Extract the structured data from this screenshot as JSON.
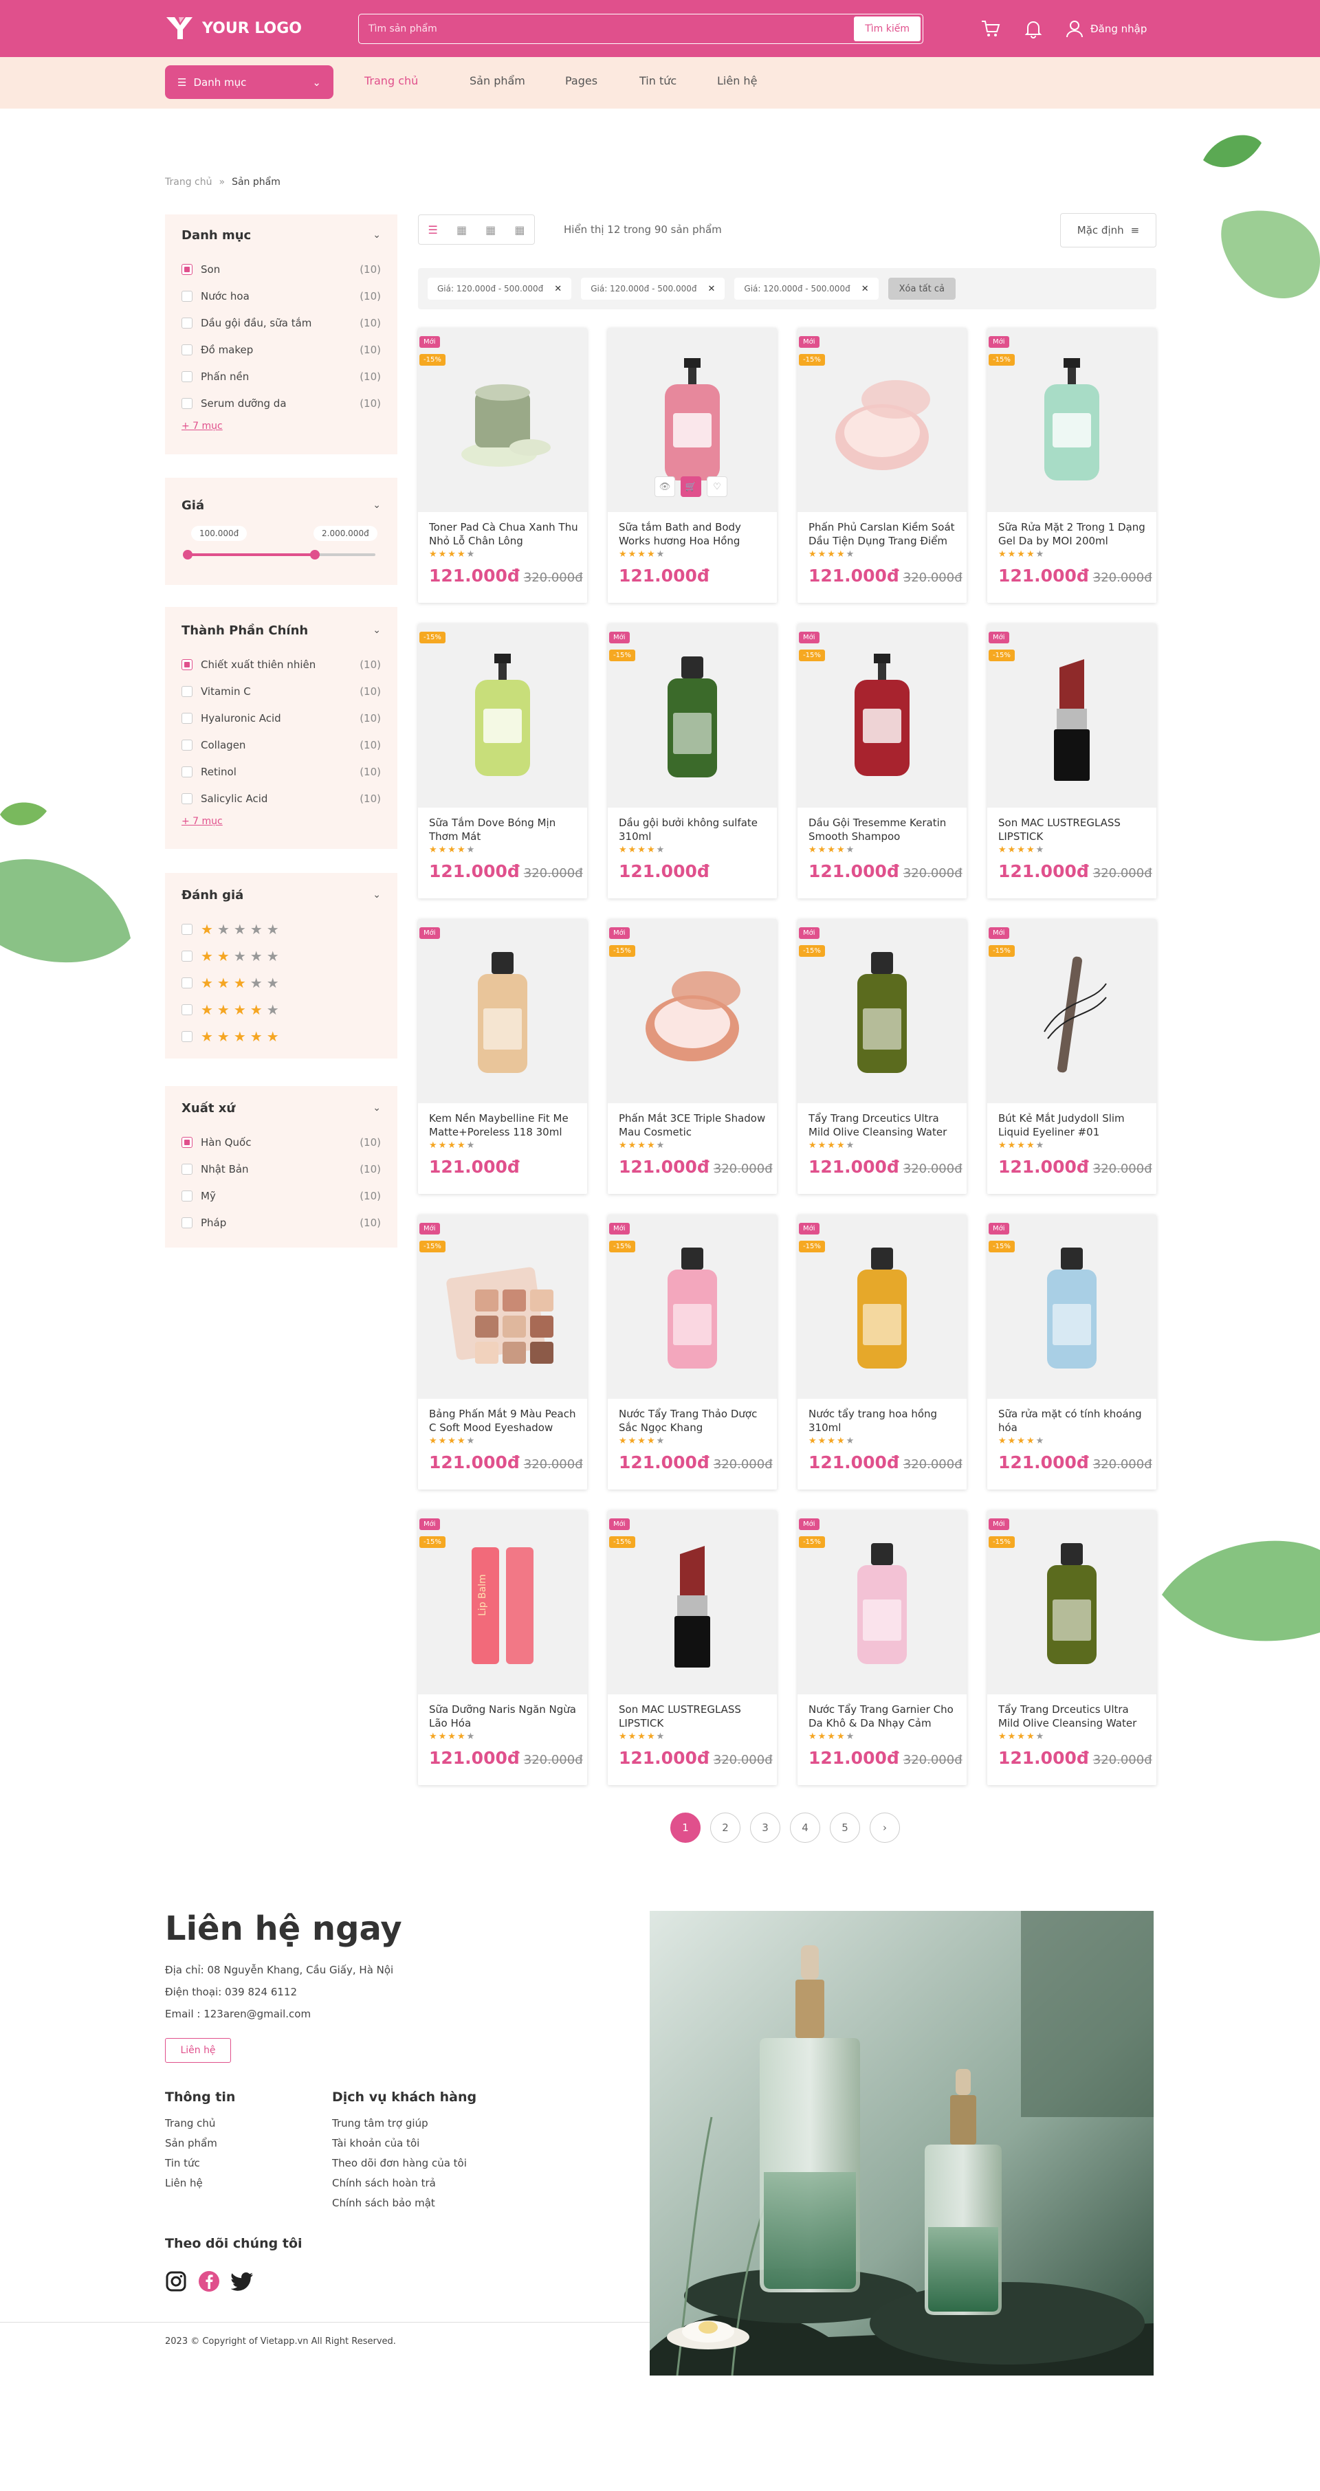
{
  "header": {
    "logo_text": "YOUR LOGO",
    "search_placeholder": "Tìm sản phẩm",
    "search_button": "Tìm kiếm",
    "login_label": "Đăng nhập"
  },
  "nav": {
    "category_button": "Danh mục",
    "links": [
      "Trang chủ",
      "Sản phẩm",
      "Pages",
      "Tin tức",
      "Liên hệ"
    ]
  },
  "breadcrumb": {
    "home": "Trang chủ",
    "current": "Sản phẩm"
  },
  "filters": {
    "category": {
      "title": "Danh mục",
      "options": [
        {
          "label": "Son",
          "count": "(10)",
          "checked": true
        },
        {
          "label": "Nước hoa",
          "count": "(10)",
          "checked": false
        },
        {
          "label": "Dầu gội đầu, sữa tắm",
          "count": "(10)",
          "checked": false
        },
        {
          "label": "Đồ makep",
          "count": "(10)",
          "checked": false
        },
        {
          "label": "Phấn nền",
          "count": "(10)",
          "checked": false
        },
        {
          "label": "Serum dưỡng da",
          "count": "(10)",
          "checked": false
        }
      ],
      "more": "+ 7 mục"
    },
    "price": {
      "title": "Giá",
      "min": "100.000đ",
      "max": "2.000.000đ",
      "range_fraction": [
        0.0,
        0.68
      ]
    },
    "ingredient": {
      "title": "Thành Phần Chính",
      "options": [
        {
          "label": "Chiết xuất thiên nhiên",
          "count": "(10)",
          "checked": true
        },
        {
          "label": "Vitamin C",
          "count": "(10)",
          "checked": false
        },
        {
          "label": "Hyaluronic Acid",
          "count": "(10)",
          "checked": false
        },
        {
          "label": "Collagen",
          "count": "(10)",
          "checked": false
        },
        {
          "label": "Retinol",
          "count": "(10)",
          "checked": false
        },
        {
          "label": "Salicylic Acid",
          "count": "(10)",
          "checked": false
        }
      ],
      "more": "+ 7 mục"
    },
    "rating": {
      "title": "Đánh giá",
      "options": [
        1,
        2,
        3,
        4,
        5
      ]
    },
    "origin": {
      "title": "Xuất xứ",
      "options": [
        {
          "label": "Hàn Quốc",
          "count": "(10)",
          "checked": true
        },
        {
          "label": "Nhật Bản",
          "count": "(10)",
          "checked": false
        },
        {
          "label": "Mỹ",
          "count": "(10)",
          "checked": false
        },
        {
          "label": "Pháp",
          "count": "(10)",
          "checked": false
        }
      ]
    }
  },
  "toolbar": {
    "showing": "Hiển thị 12 trong 90 sản phẩm",
    "sort": "Mặc định",
    "chips": [
      "Giá: 120.000đ - 500.000đ",
      "Giá: 120.000đ - 500.000đ",
      "Giá: 120.000đ - 500.000đ"
    ],
    "clear_all": "Xóa tất cả"
  },
  "products": [
    {
      "name": "Toner Pad Cà Chua Xanh Thu Nhỏ Lỗ Chân Lông",
      "price": "121.000đ",
      "old": "320.000đ",
      "new": "Mới",
      "off": "-15%",
      "stars": 4,
      "kind": "jar",
      "color": "#9aa988"
    },
    {
      "name": "Sữa tắm Bath and Body Works hương Hoa Hồng",
      "price": "121.000đ",
      "old": "",
      "new": "",
      "off": "",
      "stars": 4,
      "kind": "pump",
      "color": "#e7889c",
      "hover": true
    },
    {
      "name": "Phấn Phủ Carslan Kiềm Soát Dầu Tiện Dụng Trang Điểm",
      "price": "121.000đ",
      "old": "320.000đ",
      "new": "Mới",
      "off": "-15%",
      "stars": 4,
      "kind": "compact",
      "color": "#f2c9c6"
    },
    {
      "name": "Sữa Rửa Mặt 2 Trong 1 Dạng Gel Da by MOI 200ml",
      "price": "121.000đ",
      "old": "320.000đ",
      "new": "Mới",
      "off": "-15%",
      "stars": 4,
      "kind": "pump",
      "color": "#a8dcc6"
    },
    {
      "name": "Sữa Tắm Dove Bóng Mịn Thơm Mát",
      "price": "121.000đ",
      "old": "320.000đ",
      "new": "",
      "off": "-15%",
      "stars": 4,
      "kind": "pump",
      "color": "#c8de7a"
    },
    {
      "name": "Dầu gội bưởi không sulfate 310ml",
      "price": "121.000đ",
      "old": "",
      "new": "Mới",
      "off": "-15%",
      "stars": 4,
      "kind": "bottle",
      "color": "#3b6a2a"
    },
    {
      "name": "Dầu Gội Tresemme Keratin Smooth Shampoo",
      "price": "121.000đ",
      "old": "320.000đ",
      "new": "Mới",
      "off": "-15%",
      "stars": 4,
      "kind": "pump",
      "color": "#a8232e"
    },
    {
      "name": "Son MAC LUSTREGLASS LIPSTICK",
      "price": "121.000đ",
      "old": "320.000đ",
      "new": "Mới",
      "off": "-15%",
      "stars": 4,
      "kind": "lipstick",
      "color": "#8f2a2a"
    },
    {
      "name": "Kem Nền Maybelline Fit Me Matte+Poreless 118 30ml",
      "price": "121.000đ",
      "old": "",
      "new": "Mới",
      "off": "",
      "stars": 4,
      "kind": "bottle",
      "color": "#e9c59a"
    },
    {
      "name": "Phấn Mắt 3CE Triple Shadow Mau Cosmetic",
      "price": "121.000đ",
      "old": "320.000đ",
      "new": "Mới",
      "off": "-15%",
      "stars": 4,
      "kind": "compact",
      "color": "#e2977c"
    },
    {
      "name": "Tẩy Trang Drceutics Ultra Mild Olive Cleansing Water",
      "price": "121.000đ",
      "old": "320.000đ",
      "new": "Mới",
      "off": "-15%",
      "stars": 4,
      "kind": "bottle",
      "color": "#5b6b1e"
    },
    {
      "name": "Bút Kẻ Mắt Judydoll Slim Liquid Eyeliner #01",
      "price": "121.000đ",
      "old": "320.000đ",
      "new": "Mới",
      "off": "-15%",
      "stars": 4,
      "kind": "pen",
      "color": "#6b5a50"
    },
    {
      "name": "Bảng Phấn Mắt 9 Màu Peach C Soft Mood Eyeshadow",
      "price": "121.000đ",
      "old": "320.000đ",
      "new": "Mới",
      "off": "-15%",
      "stars": 4,
      "kind": "palette",
      "color": "#d9a58c"
    },
    {
      "name": "Nước Tẩy Trang Thảo Dược Sắc Ngọc Khang",
      "price": "121.000đ",
      "old": "320.000đ",
      "new": "Mới",
      "off": "-15%",
      "stars": 4,
      "kind": "bottle",
      "color": "#f3a7bd"
    },
    {
      "name": "Nước tẩy trang hoa hồng 310ml",
      "price": "121.000đ",
      "old": "320.000đ",
      "new": "Mới",
      "off": "-15%",
      "stars": 4,
      "kind": "bottle",
      "color": "#e6a82a"
    },
    {
      "name": "Sữa rửa mặt có tính khoáng hóa",
      "price": "121.000đ",
      "old": "320.000đ",
      "new": "Mới",
      "off": "-15%",
      "stars": 4,
      "kind": "bottle",
      "color": "#a9cfe5"
    },
    {
      "name": "Sữa Dưỡng Naris Ngăn Ngừa Lão Hóa",
      "price": "121.000đ",
      "old": "320.000đ",
      "new": "Mới",
      "off": "-15%",
      "stars": 4,
      "kind": "balm",
      "color": "#f26a7a"
    },
    {
      "name": "Son MAC LUSTREGLASS LIPSTICK",
      "price": "121.000đ",
      "old": "320.000đ",
      "new": "Mới",
      "off": "-15%",
      "stars": 4,
      "kind": "lipstick",
      "color": "#8f2a2a"
    },
    {
      "name": "Nước Tẩy Trang Garnier Cho Da Khô & Da Nhạy Cảm",
      "price": "121.000đ",
      "old": "320.000đ",
      "new": "Mới",
      "off": "-15%",
      "stars": 4,
      "kind": "bottle",
      "color": "#f3c2d5"
    },
    {
      "name": "Tẩy Trang Drceutics Ultra Mild Olive Cleansing Water",
      "price": "121.000đ",
      "old": "320.000đ",
      "new": "Mới",
      "off": "-15%",
      "stars": 4,
      "kind": "bottle",
      "color": "#5b6b1e"
    }
  ],
  "pagination": {
    "pages": [
      "1",
      "2",
      "3",
      "4",
      "5"
    ],
    "current": "1",
    "next": "›"
  },
  "footer": {
    "contact_title": "Liên hệ ngay",
    "address": "Địa chỉ: 08 Nguyễn Khang, Cầu Giấy, Hà Nội",
    "phone": "Điện thoại: 039 824 6112",
    "email": "Email : 123aren@gmail.com",
    "contact_button": "Liên hệ",
    "info_title": "Thông tin",
    "info_links": [
      "Trang chủ",
      "Sản phẩm",
      "Tin tức",
      "Liên hệ"
    ],
    "service_title": "Dịch vụ khách hàng",
    "service_links": [
      "Trung tâm trợ giúp",
      "Tài khoản của tôi",
      "Theo dõi đơn hàng của tôi",
      "Chính sách hoàn trả",
      "Chính sách bảo mật"
    ],
    "follow_title": "Theo dõi chúng tôi",
    "social": [
      "instagram-icon",
      "facebook-icon",
      "twitter-icon"
    ],
    "copyright": "2023 © Copyright of Vietapp.vn All Right Reserved."
  },
  "colors": {
    "brand": "#e0508c",
    "nav_bg": "#fce9df",
    "panel_bg": "#fdf3ef",
    "star": "#f5a623",
    "discount": "#f6a821"
  }
}
